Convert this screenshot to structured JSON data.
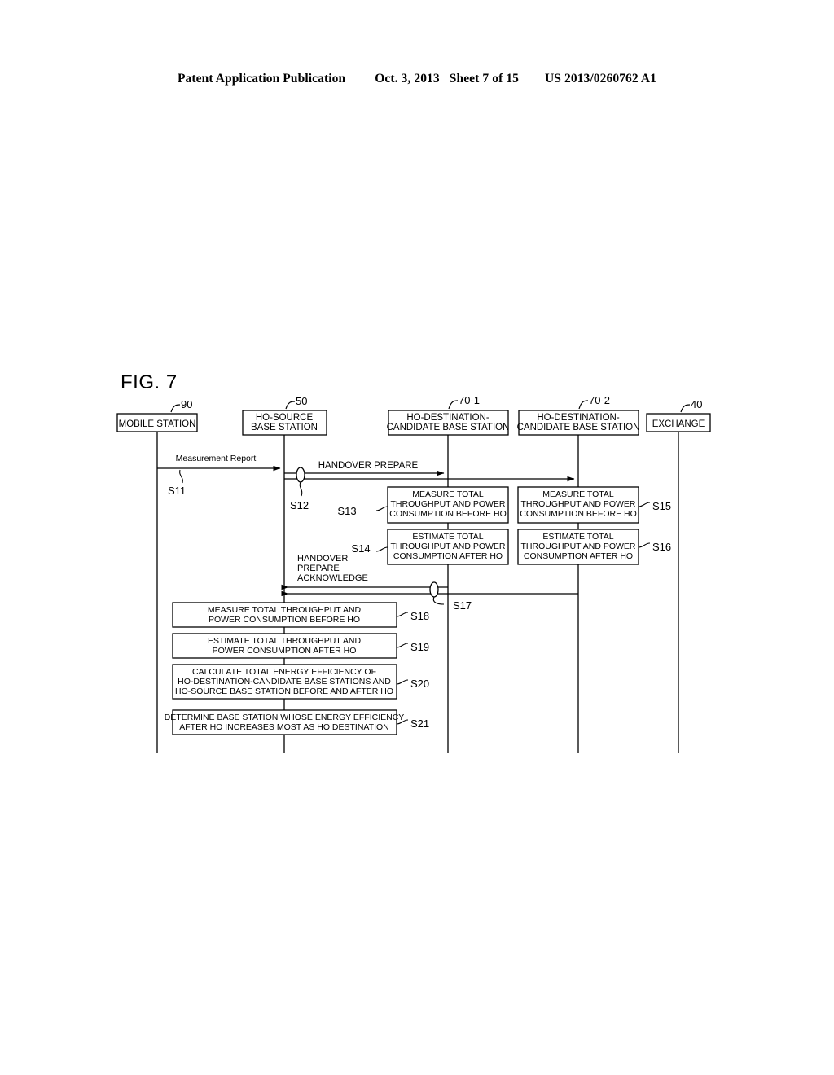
{
  "header": {
    "publication": "Patent Application Publication",
    "date": "Oct. 3, 2013",
    "sheet": "Sheet 7 of 15",
    "patent_number": "US 2013/0260762 A1"
  },
  "figure": {
    "label": "FIG. 7",
    "lifelines": [
      {
        "id": "mobile-station",
        "ref": "90",
        "lines": [
          "MOBILE STATION"
        ]
      },
      {
        "id": "ho-source-bs",
        "ref": "50",
        "lines": [
          "HO-SOURCE",
          "BASE STATION"
        ]
      },
      {
        "id": "ho-dest-candidate-1",
        "ref": "70-1",
        "lines": [
          "HO-DESTINATION-",
          "CANDIDATE BASE STATION"
        ]
      },
      {
        "id": "ho-dest-candidate-2",
        "ref": "70-2",
        "lines": [
          "HO-DESTINATION-",
          "CANDIDATE BASE STATION"
        ]
      },
      {
        "id": "exchange",
        "ref": "40",
        "lines": [
          "EXCHANGE"
        ]
      }
    ],
    "messages": [
      {
        "id": "measurement-report",
        "label": "Measurement Report",
        "step": "S11"
      },
      {
        "id": "handover-prepare",
        "label": "HANDOVER PREPARE",
        "step": "S12"
      },
      {
        "id": "handover-prepare-acknowledge",
        "label_lines": [
          "HANDOVER",
          "PREPARE",
          "ACKNOWLEDGE"
        ],
        "step": "S17"
      }
    ],
    "process_boxes": [
      {
        "step": "S13",
        "lines": [
          "MEASURE TOTAL",
          "THROUGHPUT AND POWER",
          "CONSUMPTION BEFORE HO"
        ]
      },
      {
        "step": "S15",
        "lines": [
          "MEASURE TOTAL",
          "THROUGHPUT AND POWER",
          "CONSUMPTION BEFORE HO"
        ]
      },
      {
        "step": "S14",
        "lines": [
          "ESTIMATE TOTAL",
          "THROUGHPUT AND POWER",
          "CONSUMPTION AFTER HO"
        ]
      },
      {
        "step": "S16",
        "lines": [
          "ESTIMATE TOTAL",
          "THROUGHPUT AND POWER",
          "CONSUMPTION AFTER HO"
        ]
      },
      {
        "step": "S18",
        "lines": [
          "MEASURE TOTAL THROUGHPUT AND",
          "POWER CONSUMPTION BEFORE HO"
        ]
      },
      {
        "step": "S19",
        "lines": [
          "ESTIMATE TOTAL THROUGHPUT AND",
          "POWER CONSUMPTION AFTER HO"
        ]
      },
      {
        "step": "S20",
        "lines": [
          "CALCULATE TOTAL ENERGY EFFICIENCY OF",
          "HO-DESTINATION-CANDIDATE BASE STATIONS AND",
          "HO-SOURCE BASE STATION BEFORE AND AFTER HO"
        ]
      },
      {
        "step": "S21",
        "lines": [
          "DETERMINE BASE STATION WHOSE ENERGY EFFICIENCY",
          "AFTER HO INCREASES MOST AS HO DESTINATION"
        ]
      }
    ]
  },
  "colors": {
    "ink": "#000000",
    "paper": "#ffffff"
  }
}
